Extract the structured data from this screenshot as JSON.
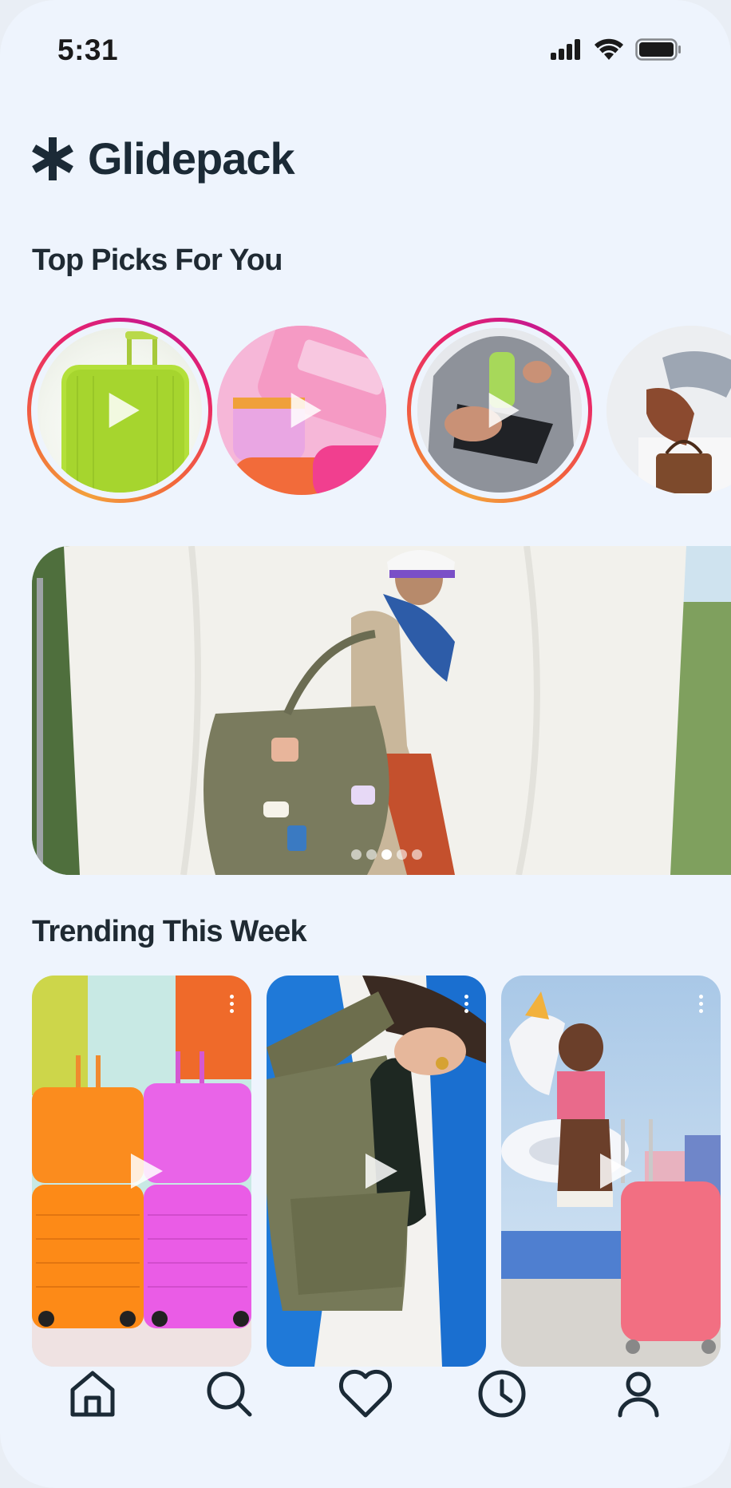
{
  "status_bar": {
    "time": "5:31"
  },
  "app": {
    "name": "Glidepack",
    "logo_icon": "asterisk-logo-icon"
  },
  "top_picks": {
    "title": "Top Picks For You",
    "stories": [
      {
        "subject": "lime green hardshell suitcase",
        "unseen": true
      },
      {
        "subject": "pink organizer pouches",
        "unseen": false
      },
      {
        "subject": "black sling bag with water bottle",
        "unseen": true
      },
      {
        "subject": "person sitting with brown tote",
        "unseen": false
      }
    ]
  },
  "hero_carousel": {
    "subject": "model with olive tote bag in front of white backdrop",
    "slides": 5,
    "active_slide": 3
  },
  "trending": {
    "title": "Trending This Week",
    "cards": [
      {
        "subject": "orange and pink rolling luggage"
      },
      {
        "subject": "olive sling bag holding black bottle"
      },
      {
        "subject": "woman with inflatable and pink suitcase"
      }
    ]
  },
  "bottom_nav": {
    "items": [
      {
        "icon": "home-icon",
        "active": true
      },
      {
        "icon": "search-icon",
        "active": false
      },
      {
        "icon": "heart-icon",
        "active": false
      },
      {
        "icon": "clock-icon",
        "active": false
      },
      {
        "icon": "profile-icon",
        "active": false
      }
    ]
  },
  "colors": {
    "background": "#eef4fd",
    "text": "#1b2a36",
    "ring_start": "#f3a03b",
    "ring_end": "#c8198d"
  }
}
